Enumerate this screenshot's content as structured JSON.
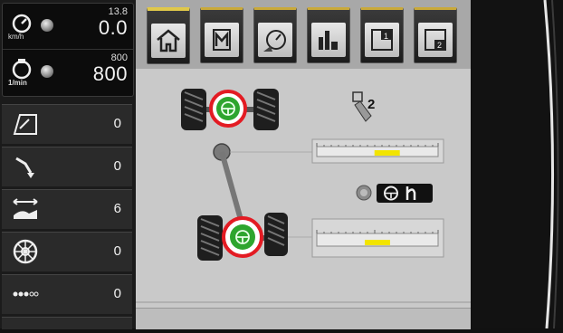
{
  "left_panel": {
    "speed": {
      "unit": "km/h",
      "preset": "13.8",
      "value": "0.0"
    },
    "rpm": {
      "unit": "1/min",
      "preset": "800",
      "value": "800"
    },
    "items": [
      {
        "icon": "field-area-icon",
        "value": "0"
      },
      {
        "icon": "implement-lift-icon",
        "value": "0"
      },
      {
        "icon": "working-width-icon",
        "value": "6"
      },
      {
        "icon": "wheel-icon",
        "value": "0"
      },
      {
        "icon": "chain-link-icon",
        "value": "0"
      }
    ]
  },
  "tabs": [
    {
      "icon": "home-icon"
    },
    {
      "icon": "memory-icon"
    },
    {
      "icon": "stopwatch-icon"
    },
    {
      "icon": "bar-chart-icon"
    },
    {
      "icon": "page-1-icon",
      "label": "1"
    },
    {
      "icon": "page-2-icon",
      "label": "2"
    }
  ],
  "steering": {
    "mode_number": "2",
    "front_slider": {
      "label": "front-axle-position",
      "level": 0.58
    },
    "rear_slider": {
      "label": "rear-axle-position",
      "level": 0.5
    },
    "accent": "#f2e400",
    "highlight": "#e31b23",
    "active_green": "#2ea52e"
  }
}
